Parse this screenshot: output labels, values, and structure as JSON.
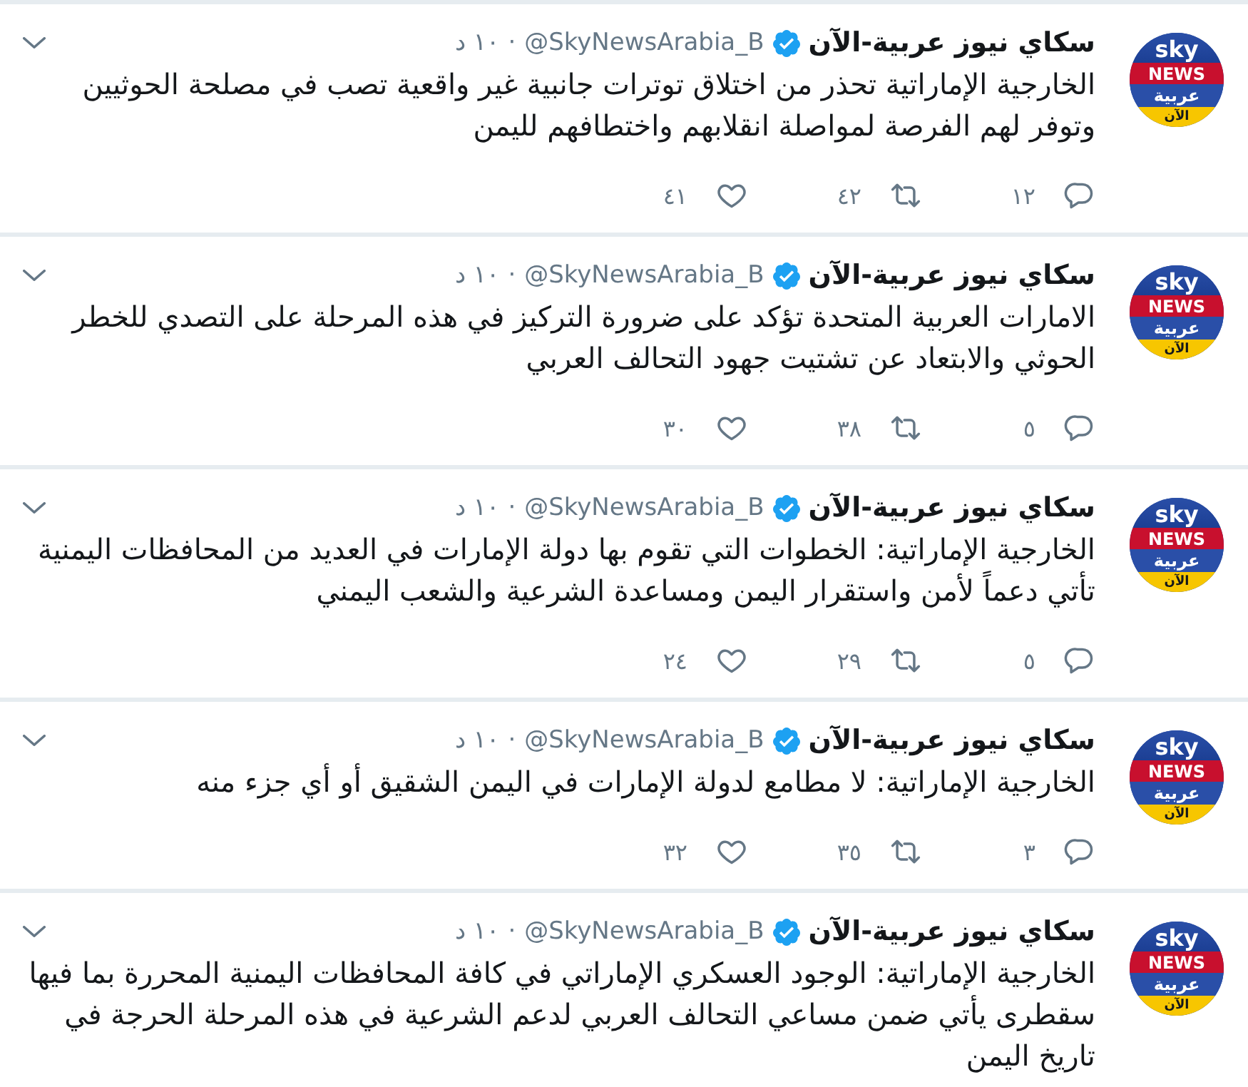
{
  "tweets": [
    {
      "avatar": {
        "logo_lines": [
          "sky",
          "NEWS",
          "عربية",
          "الآن"
        ]
      },
      "name": "سكاي نيوز عربية-الآن",
      "verified": true,
      "handle": "@SkyNewsArabia_B",
      "separator": "·",
      "time": "١٠ د",
      "text": "الخارجية الإماراتية تحذر من اختلاق توترات جانبية غير واقعية تصب في مصلحة الحوثيين وتوفر لهم الفرصة لمواصلة انقلابهم واختطافهم لليمن",
      "actions": [
        {
          "kind": "reply",
          "count": "١٢"
        },
        {
          "kind": "retweet",
          "count": "٤٢"
        },
        {
          "kind": "like",
          "count": "٤١"
        }
      ]
    },
    {
      "avatar": {
        "logo_lines": [
          "sky",
          "NEWS",
          "عربية",
          "الآن"
        ]
      },
      "name": "سكاي نيوز عربية-الآن",
      "verified": true,
      "handle": "@SkyNewsArabia_B",
      "separator": "·",
      "time": "١٠ د",
      "text": "الامارات العربية المتحدة تؤكد على ضرورة التركيز في هذه المرحلة على التصدي للخطر الحوثي والابتعاد عن تشتيت جهود التحالف العربي",
      "actions": [
        {
          "kind": "reply",
          "count": "٥"
        },
        {
          "kind": "retweet",
          "count": "٣٨"
        },
        {
          "kind": "like",
          "count": "٣٠"
        }
      ]
    },
    {
      "avatar": {
        "logo_lines": [
          "sky",
          "NEWS",
          "عربية",
          "الآن"
        ]
      },
      "name": "سكاي نيوز عربية-الآن",
      "verified": true,
      "handle": "@SkyNewsArabia_B",
      "separator": "·",
      "time": "١٠ د",
      "text": "الخارجية الإماراتية: الخطوات التي تقوم بها دولة الإمارات في العديد من المحافظات اليمنية تأتي دعماً لأمن واستقرار اليمن ومساعدة الشرعية والشعب اليمني",
      "actions": [
        {
          "kind": "reply",
          "count": "٥"
        },
        {
          "kind": "retweet",
          "count": "٢٩"
        },
        {
          "kind": "like",
          "count": "٢٤"
        }
      ]
    },
    {
      "avatar": {
        "logo_lines": [
          "sky",
          "NEWS",
          "عربية",
          "الآن"
        ]
      },
      "name": "سكاي نيوز عربية-الآن",
      "verified": true,
      "handle": "@SkyNewsArabia_B",
      "separator": "·",
      "time": "١٠ د",
      "text": "الخارجية الإماراتية: لا مطامع لدولة الإمارات في اليمن الشقيق أو أي جزء منه",
      "actions": [
        {
          "kind": "reply",
          "count": "٣"
        },
        {
          "kind": "retweet",
          "count": "٣٥"
        },
        {
          "kind": "like",
          "count": "٣٢"
        }
      ]
    },
    {
      "avatar": {
        "logo_lines": [
          "sky",
          "NEWS",
          "عربية",
          "الآن"
        ]
      },
      "name": "سكاي نيوز عربية-الآن",
      "verified": true,
      "handle": "@SkyNewsArabia_B",
      "separator": "·",
      "time": "١٠ د",
      "text": "الخارجية الإماراتية: الوجود العسكري الإماراتي في كافة المحافظات اليمنية المحررة بما فيها سقطرى يأتي ضمن مساعي التحالف العربي لدعم الشرعية في هذه المرحلة الحرجة في تاريخ اليمن"
    }
  ]
}
